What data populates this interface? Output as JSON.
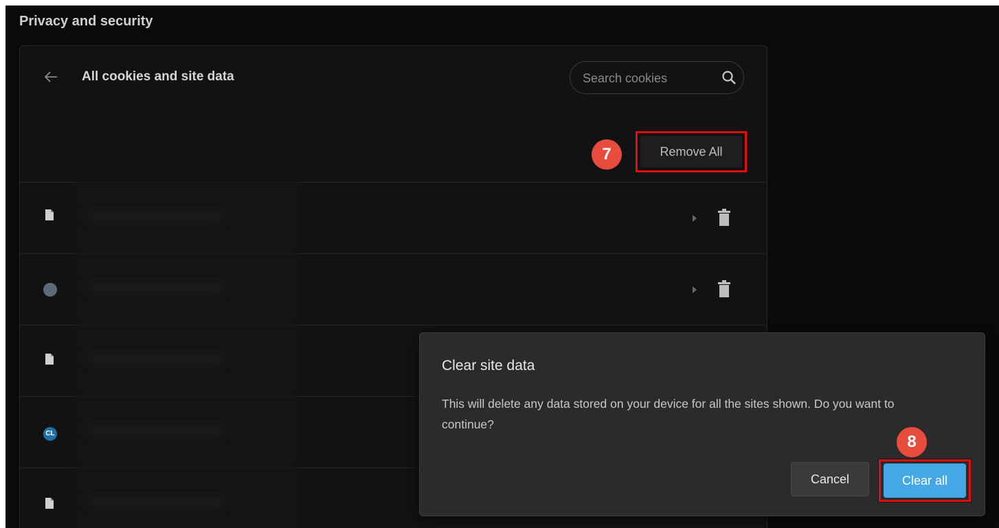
{
  "section": {
    "title": "Privacy and security"
  },
  "card": {
    "title": "All cookies and site data",
    "search": {
      "placeholder": "Search cookies",
      "value": ""
    },
    "remove_all_label": "Remove All"
  },
  "steps": {
    "remove": "7",
    "clear": "8"
  },
  "rows": [
    {
      "icon": "file-icon"
    },
    {
      "icon": "site-favicon"
    },
    {
      "icon": "file-icon"
    },
    {
      "icon": "site-favicon",
      "favicon_text": "CL"
    },
    {
      "icon": "file-icon"
    }
  ],
  "dialog": {
    "title": "Clear site data",
    "message": "This will delete any data stored on your device for all the sites shown. Do you want to continue?",
    "cancel_label": "Cancel",
    "confirm_label": "Clear all"
  },
  "colors": {
    "background": "#0a0a0a",
    "card": "#121212",
    "dialog": "#2b2b2b",
    "accent": "#45a7e6",
    "highlight": "#e20d0d",
    "badge": "#e84c3d"
  }
}
